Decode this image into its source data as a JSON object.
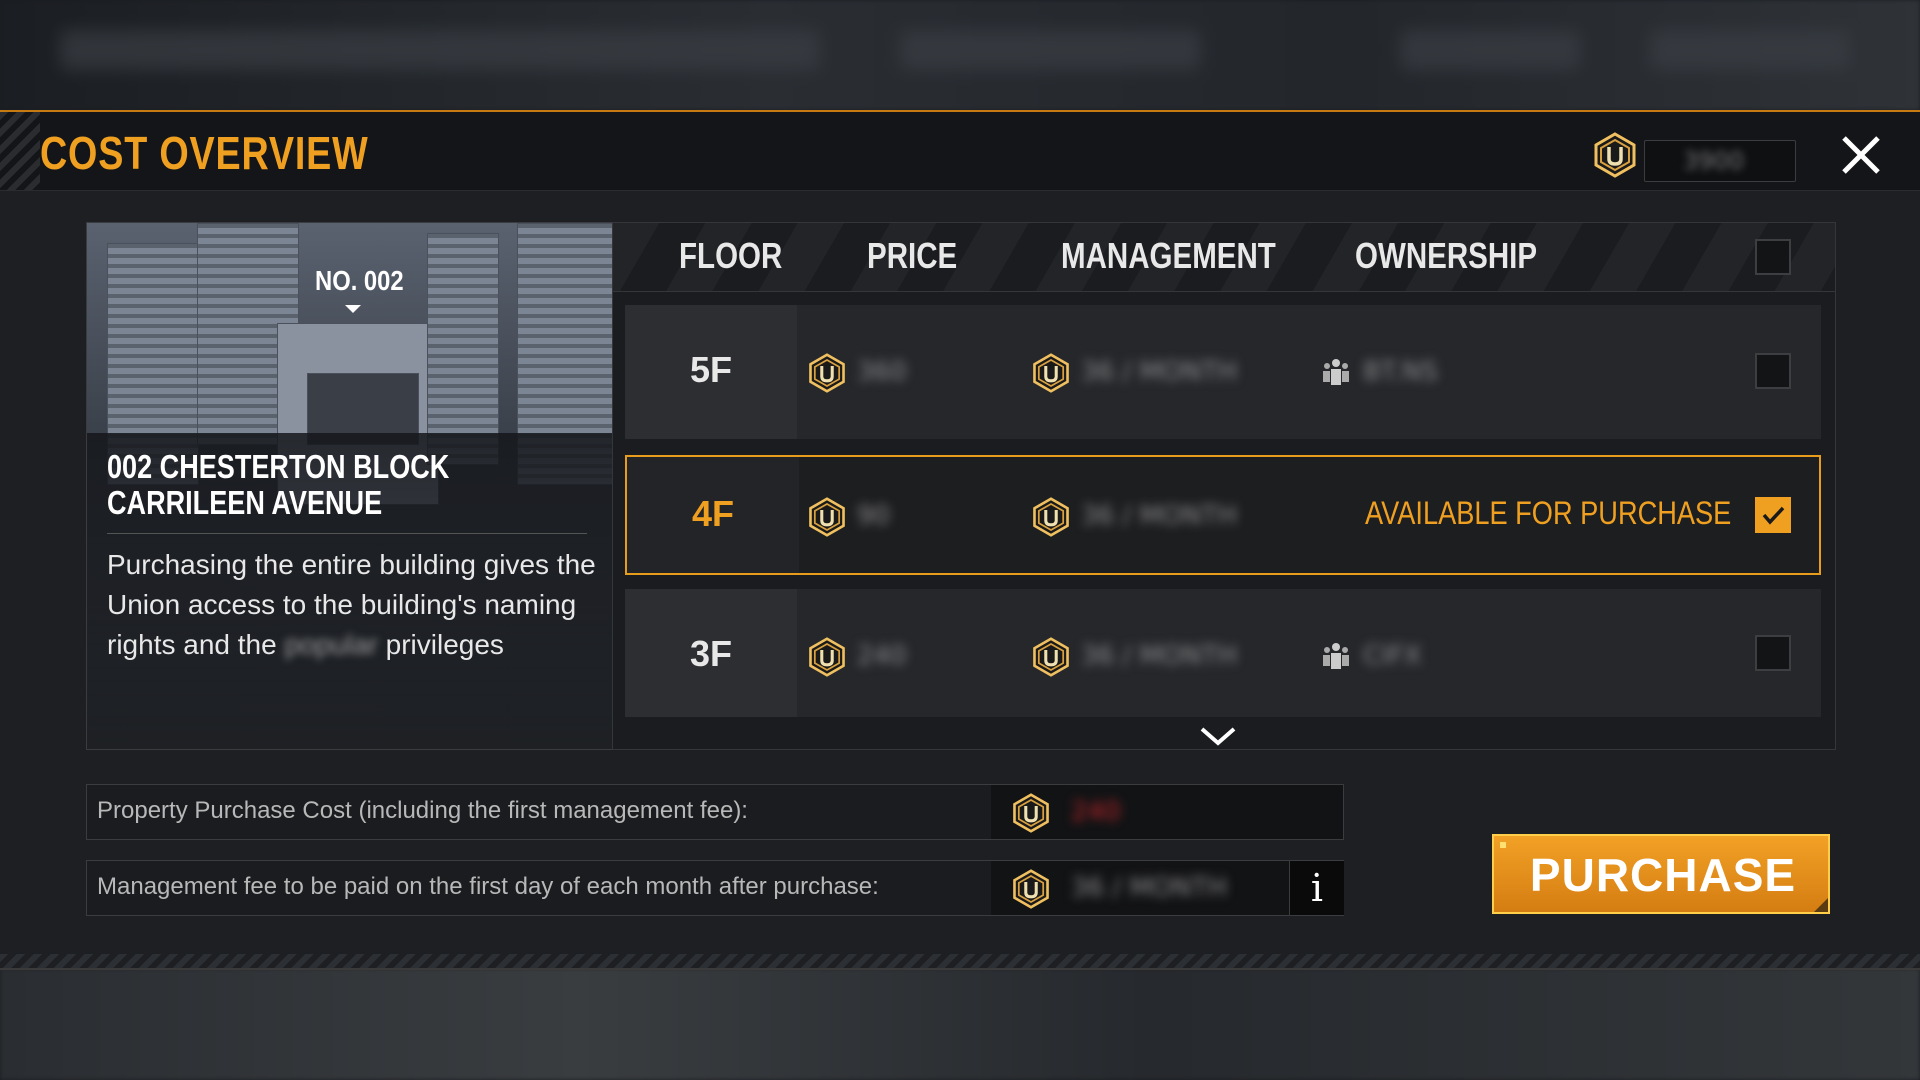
{
  "header": {
    "title": "COST OVERVIEW",
    "currency_balance": "3900"
  },
  "building": {
    "number": "NO. 002",
    "address_line1": "002 CHESTERTON BLOCK",
    "address_line2": "CARRILEEN AVENUE",
    "description": "Purchasing the entire building gives the Union access to the building's naming rights and the",
    "description_blurred": "popular",
    "description_end": "privileges"
  },
  "table": {
    "headers": [
      "FLOOR",
      "PRICE",
      "MANAGEMENT",
      "OWNERSHIP"
    ],
    "rows": [
      {
        "floor": "5F",
        "price": "360",
        "management": "36 / MONTH",
        "ownership": "BT.NS",
        "selected": false
      },
      {
        "floor": "4F",
        "price": "90",
        "management": "36 / MONTH",
        "ownership": "AVAILABLE FOR PURCHASE",
        "selected": true
      },
      {
        "floor": "3F",
        "price": "240",
        "management": "36 / MONTH",
        "ownership": "CIFX",
        "selected": false
      }
    ]
  },
  "summary": {
    "purchase_cost_label": "Property Purchase Cost (including the first management fee):",
    "purchase_cost_value": "240",
    "monthly_fee_label": "Management fee to be paid on the first day of each month after purchase:",
    "monthly_fee_value": "36 / MONTH",
    "info_label": "i"
  },
  "purchase_button": "PURCHASE",
  "colors": {
    "accent": "#f0a020",
    "panel": "#1d1f22",
    "warning_value": "#c0262a"
  },
  "icons": [
    "union-coin-icon",
    "close-icon",
    "ownership-group-icon",
    "checkmark-icon",
    "chevron-down-icon",
    "info-icon"
  ]
}
